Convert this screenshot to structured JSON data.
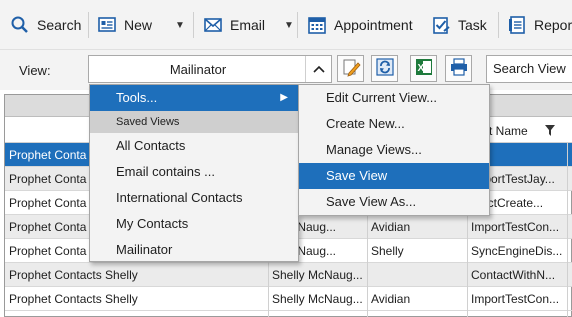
{
  "toolbar": {
    "search": "Search",
    "new": "New",
    "email": "Email",
    "appointment": "Appointment",
    "task": "Task",
    "reports": "Repor"
  },
  "view": {
    "label": "View:",
    "selected": "Mailinator",
    "search_placeholder": "Search View"
  },
  "grid": {
    "header_last_name": "st Name",
    "rows": [
      {
        "c0": "Prophet Conta",
        "c1": "",
        "c2": "",
        "c3": "e",
        "style": "sel"
      },
      {
        "c0": "Prophet Conta",
        "c1": "",
        "c2": "",
        "c3": "ImportTestJay...",
        "style": "alt"
      },
      {
        "c0": "Prophet Conta",
        "c1": "",
        "c2": "",
        "c3": "ntactCreate...",
        "style": "plain"
      },
      {
        "c0": "Prophet Conta",
        "c1": "y McNaug...",
        "c2": "Avidian",
        "c3": "ImportTestCon...",
        "style": "alt"
      },
      {
        "c0": "Prophet Conta",
        "c1": "y McNaug...",
        "c2": "Shelly",
        "c3": "SyncEngineDis...",
        "style": "plain"
      },
      {
        "c0": "Prophet Contacts Shelly",
        "c1": "Shelly McNaug...",
        "c2": "",
        "c3": "ContactWithN...",
        "style": "alt"
      },
      {
        "c0": "Prophet Contacts Shelly",
        "c1": "Shelly McNaug...",
        "c2": "Avidian",
        "c3": "ImportTestCon...",
        "style": "plain"
      }
    ]
  },
  "menu": {
    "tools": "Tools...",
    "saved_views_header": "Saved Views",
    "saved_views": [
      "All Contacts",
      "Email contains ...",
      "International Contacts",
      "My Contacts",
      "Mailinator"
    ]
  },
  "submenu": {
    "items": [
      "Edit Current View...",
      "Create New...",
      "Manage Views...",
      "Save View",
      "Save View As..."
    ],
    "highlighted": "Save View"
  },
  "colors": {
    "accent": "#1e6fbb",
    "toolbar_bg": "#f3f3f3"
  }
}
